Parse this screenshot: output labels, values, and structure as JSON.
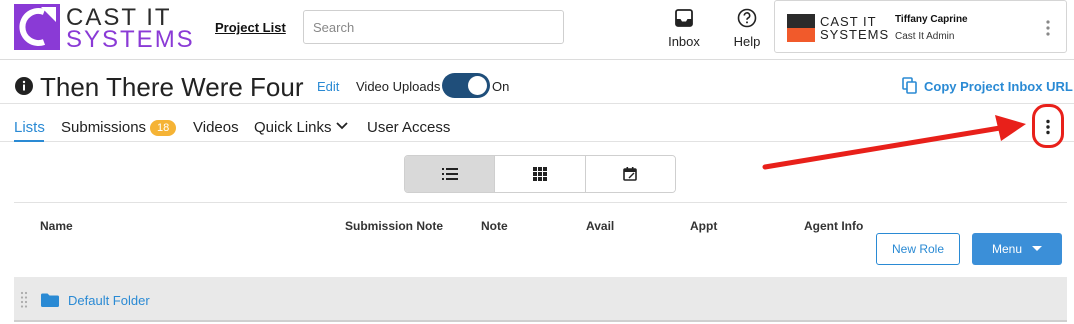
{
  "header": {
    "logo": {
      "line1": "CAST IT",
      "line2": "SYSTEMS"
    },
    "nav_project_list": "Project List",
    "search_placeholder": "Search",
    "inbox_label": "Inbox",
    "help_label": "Help",
    "account": {
      "brand_line1": "CAST IT",
      "brand_line2": "SYSTEMS",
      "user_name": "Tiffany Caprine",
      "user_role": "Cast It Admin"
    }
  },
  "project": {
    "title": "Then There Were Four",
    "edit_label": "Edit",
    "video_uploads_label": "Video Uploads",
    "video_uploads_state": "On",
    "copy_url_label": "Copy Project Inbox URL"
  },
  "tabs": [
    {
      "label": "Lists",
      "active": true
    },
    {
      "label": "Submissions",
      "badge": "18"
    },
    {
      "label": "Videos"
    },
    {
      "label": "Quick Links"
    },
    {
      "label": "User Access"
    }
  ],
  "view_switch": {
    "options": [
      "list-view-icon",
      "grid-view-icon",
      "calendar-view-icon"
    ],
    "selected": "list-view-icon"
  },
  "table": {
    "columns": [
      "Name",
      "Submission Note",
      "Note",
      "Avail",
      "Appt",
      "Agent Info"
    ]
  },
  "actions": {
    "new_role": "New Role",
    "menu": "Menu"
  },
  "folders": [
    {
      "name": "Default Folder"
    }
  ],
  "colors": {
    "accent": "#2a8ad4",
    "brand_purple": "#8a3ad6",
    "toggle": "#1f4e7a",
    "badge": "#f5b335",
    "annotation": "#e8201a",
    "brand_orange": "#f15a2b"
  }
}
